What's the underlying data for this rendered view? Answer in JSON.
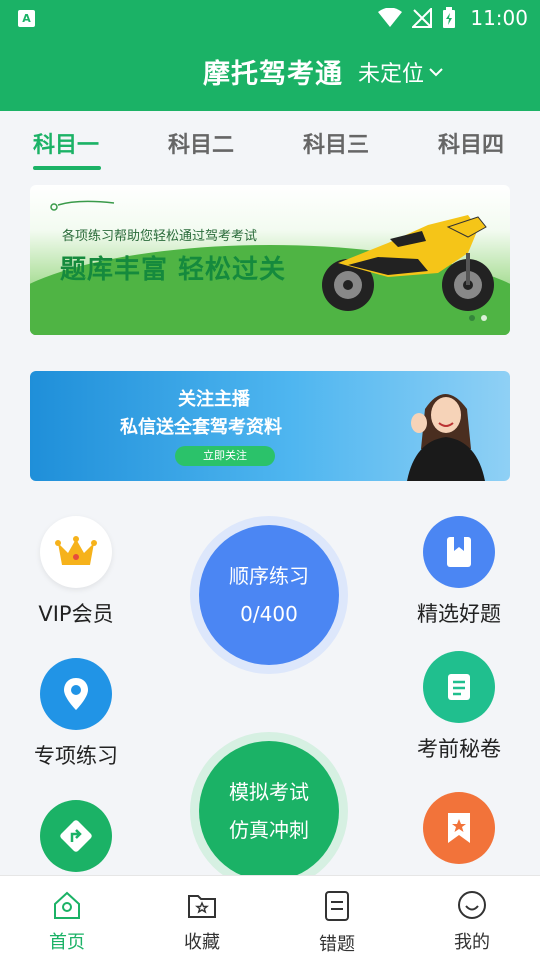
{
  "status_bar": {
    "time": "11:00"
  },
  "header": {
    "title": "摩托驾考通",
    "location": "未定位"
  },
  "subject_tabs": [
    {
      "label": "科目一",
      "active": true
    },
    {
      "label": "科目二",
      "active": false
    },
    {
      "label": "科目三",
      "active": false
    },
    {
      "label": "科目四",
      "active": false
    }
  ],
  "banner1": {
    "subtitle": "各项练习帮助您轻松通过驾考考试",
    "headline": "题库丰富  轻松过关"
  },
  "banner2": {
    "line1": "关注主播",
    "line2": "私信送全套驾考资料",
    "button": "立即关注"
  },
  "features": {
    "vip": "VIP会员",
    "special": "专项练习",
    "selected": "精选好题",
    "secret": "考前秘卷"
  },
  "sequential": {
    "label": "顺序练习",
    "progress": "0/400"
  },
  "mock": {
    "line1": "模拟考试",
    "line2": "仿真冲刺"
  },
  "bottom_nav": [
    {
      "label": "首页",
      "icon": "home-icon",
      "active": true
    },
    {
      "label": "收藏",
      "icon": "favorite-folder-icon",
      "active": false
    },
    {
      "label": "错题",
      "icon": "wrong-questions-icon",
      "active": false
    },
    {
      "label": "我的",
      "icon": "profile-smile-icon",
      "active": false
    }
  ],
  "colors": {
    "primary": "#1bb266",
    "blue": "#4b86f3",
    "orange": "#f2733a"
  }
}
